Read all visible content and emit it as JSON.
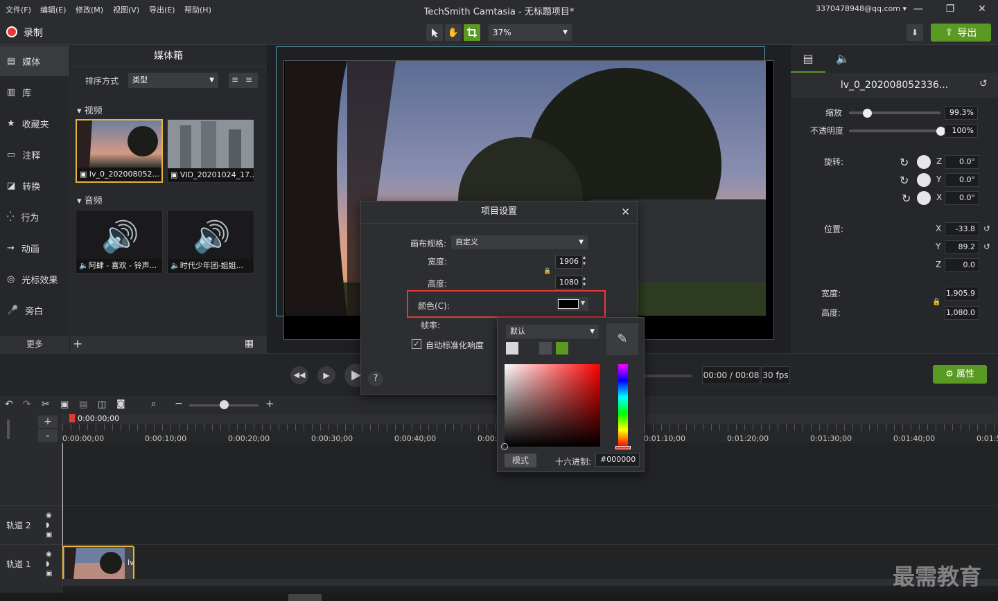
{
  "menu": [
    "文件(F)",
    "编辑(E)",
    "修改(M)",
    "视图(V)",
    "导出(E)",
    "帮助(H)"
  ],
  "app_title": "TechSmith Camtasia - 无标题项目*",
  "account": "3370478948@qq.com",
  "record_label": "录制",
  "zoom_level": "37%",
  "export_label": "导出",
  "sidebar": {
    "items": [
      {
        "label": "媒体",
        "icon": "film-icon"
      },
      {
        "label": "库",
        "icon": "library-icon"
      },
      {
        "label": "收藏夹",
        "icon": "star-icon"
      },
      {
        "label": "注释",
        "icon": "annotation-icon"
      },
      {
        "label": "转换",
        "icon": "transition-icon"
      },
      {
        "label": "行为",
        "icon": "behavior-icon"
      },
      {
        "label": "动画",
        "icon": "animation-icon"
      },
      {
        "label": "光标效果",
        "icon": "cursor-icon"
      },
      {
        "label": "旁白",
        "icon": "microphone-icon"
      }
    ],
    "more_label": "更多"
  },
  "media_bin": {
    "title": "媒体箱",
    "sort_label": "排序方式",
    "sort_value": "类型",
    "video_section": "视频",
    "audio_section": "音频",
    "videos": [
      "lv_0_202008052...",
      "VID_20201024_17..."
    ],
    "audios": [
      "阿肆 - 喜欢 - 铃声...",
      "时代少年团-姐姐..."
    ]
  },
  "properties": {
    "clip_name": "lv_0_202008052336...",
    "scale_label": "缩放",
    "scale_value": "99.3%",
    "scale_level": 0.2,
    "opacity_label": "不透明度",
    "opacity_value": "100%",
    "opacity_level": 1.0,
    "rotation_label": "旋转:",
    "rot_z": "0.0°",
    "rot_y": "0.0°",
    "rot_x": "0.0°",
    "position_label": "位置:",
    "pos_x": "-33.8",
    "pos_y": "89.2",
    "pos_z": "0.0",
    "width_label": "宽度:",
    "width_value": "1,905.9",
    "height_label": "高度:",
    "height_value": "1,080.0",
    "axis_z": "Z",
    "axis_y": "Y",
    "axis_x": "X",
    "props_button": "属性"
  },
  "dialog": {
    "title": "项目设置",
    "canvas_label": "画布规格:",
    "canvas_value": "自定义",
    "width_label": "宽度:",
    "width_value": "1906",
    "height_label": "高度:",
    "height_value": "1080",
    "color_label": "颜色(C):",
    "framerate_label": "帧率:",
    "auto_label": "自动标准化响度",
    "help": "?"
  },
  "picker": {
    "preset": "默认",
    "mode_label": "模式",
    "hex_label": "十六进制:",
    "hex_value": "#000000"
  },
  "transport": {
    "time": "00:00 / 00:08",
    "fps": "30 fps"
  },
  "timeline": {
    "playhead": "0:00:00;00",
    "ticks": [
      "0:00:00;00",
      "0:00:10;00",
      "0:00:20;00",
      "0:00:30;00",
      "0:00:40;00",
      "0:00:5",
      "0:01:10;00",
      "0:01:20;00",
      "0:01:30;00",
      "0:01:40;00",
      "0:01:5"
    ],
    "tracks": [
      "轨道 2",
      "轨道 1"
    ]
  },
  "watermark": "最需教育",
  "colors": {
    "accent": "#5a9a23",
    "highlight": "#e53935"
  }
}
